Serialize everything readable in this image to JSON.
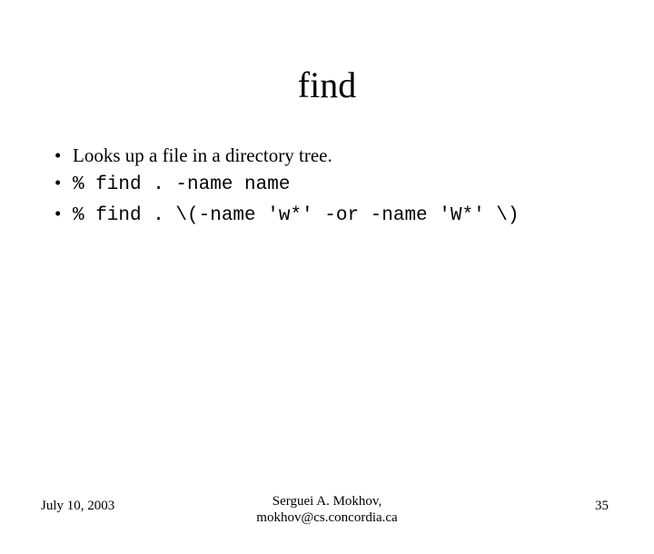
{
  "title": "find",
  "bullets": [
    {
      "text": "Looks up a file in a directory tree.",
      "mono": false
    },
    {
      "text": "% find . -name name",
      "mono": true
    },
    {
      "text": "% find . \\(-name 'w*' -or -name 'W*' \\)",
      "mono": true
    }
  ],
  "footer": {
    "date": "July 10, 2003",
    "author_line1": "Serguei A. Mokhov,",
    "author_line2": "mokhov@cs.concordia.ca",
    "page": "35"
  }
}
